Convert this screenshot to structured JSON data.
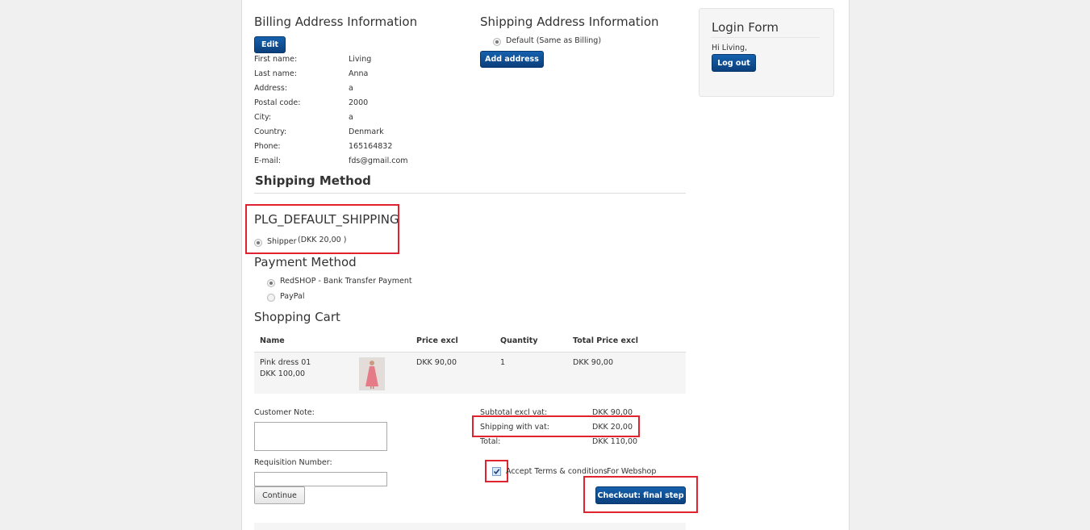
{
  "billing": {
    "title": "Billing Address Information",
    "edit_label": "Edit",
    "fields": [
      {
        "label": "First name:",
        "value": "Living"
      },
      {
        "label": "Last name:",
        "value": "Anna"
      },
      {
        "label": "Address:",
        "value": "a"
      },
      {
        "label": "Postal code:",
        "value": "2000"
      },
      {
        "label": "City:",
        "value": "a"
      },
      {
        "label": "Country:",
        "value": "Denmark"
      },
      {
        "label": "Phone:",
        "value": "165164832"
      },
      {
        "label": "E-mail:",
        "value": "fds@gmail.com"
      }
    ]
  },
  "shipping_address": {
    "title": "Shipping Address Information",
    "default_option": "Default (Same as Billing)",
    "add_label": "Add address"
  },
  "shipping_method": {
    "title": "Shipping Method",
    "plugin": "PLG_DEFAULT_SHIPPING",
    "option_label": "Shipper",
    "option_price": "(DKK 20,00 )"
  },
  "payment": {
    "title": "Payment Method",
    "options": [
      "RedSHOP - Bank Transfer Payment",
      "PayPal"
    ]
  },
  "cart": {
    "title": "Shopping Cart",
    "headers": [
      "Name",
      "Price excl",
      "Quantity",
      "Total Price excl"
    ],
    "item": {
      "name": "Pink dress 01",
      "original_price": "DKK 100,00",
      "price": "DKK 90,00",
      "quantity": "1",
      "total": "DKK 90,00"
    }
  },
  "totals": {
    "subtotal_label": "Subtotal excl vat:",
    "subtotal_value": "DKK 90,00",
    "shipping_label": "Shipping with vat:",
    "shipping_value": "DKK 20,00",
    "total_label": "Total:",
    "total_value": "DKK 110,00"
  },
  "form": {
    "customer_note_label": "Customer Note:",
    "requisition_label": "Requisition Number:",
    "continue_label": "Continue",
    "terms_label": "Accept Terms & conditions",
    "terms_link": "For Webshop",
    "checkout_label": "Checkout: final step"
  },
  "login": {
    "title": "Login Form",
    "greeting": "Hi Living,",
    "logout_label": "Log out"
  },
  "colors": {
    "button": "#0d4a8f",
    "highlight": "#e0232e",
    "link": "#2a6db5"
  }
}
